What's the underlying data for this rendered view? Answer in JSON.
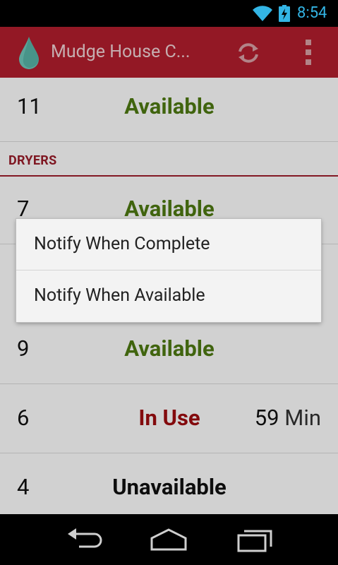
{
  "status_bar": {
    "time": "8:54",
    "wifi_icon": "wifi-icon",
    "battery_icon": "battery-charging-icon",
    "accent_color": "#33b5e5"
  },
  "action_bar": {
    "title": "Mudge House C...",
    "app_icon": "water-drop-icon",
    "refresh_icon": "refresh-icon",
    "overflow_icon": "overflow-menu-icon",
    "color": "#b41e2e"
  },
  "rows_top": [
    {
      "number": "11",
      "status": "Available",
      "state": "available"
    }
  ],
  "section": {
    "label": "DRYERS"
  },
  "rows_dryers": [
    {
      "number": "7",
      "status": "Available",
      "state": "available",
      "time_value": "",
      "time_unit": ""
    },
    {
      "number": "9",
      "status": "Available",
      "state": "available",
      "time_value": "",
      "time_unit": ""
    },
    {
      "number": "6",
      "status": "In Use",
      "state": "inuse",
      "time_value": "59",
      "time_unit": "Min"
    },
    {
      "number": "4",
      "status": "Unavailable",
      "state": "unavailable",
      "time_value": "",
      "time_unit": ""
    }
  ],
  "dialog": {
    "items": [
      {
        "label": "Notify When Complete"
      },
      {
        "label": "Notify When Available"
      }
    ]
  },
  "nav_bar": {
    "back_icon": "back-icon",
    "home_icon": "home-icon",
    "recents_icon": "recent-apps-icon"
  },
  "colors": {
    "available": "#4f7b12",
    "in_use": "#a00d10",
    "section": "#9b1d2a"
  }
}
